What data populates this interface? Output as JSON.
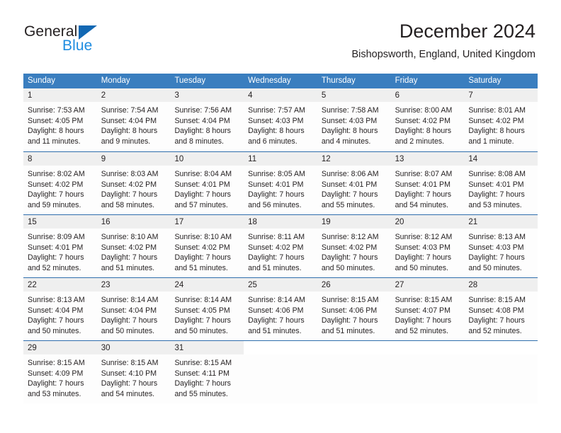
{
  "brand": {
    "name_part1": "General",
    "name_part2": "Blue",
    "triangle_icon": "triangle-icon",
    "color_dark": "#231f20",
    "color_blue": "#1e8ce0",
    "color_triangle": "#1268b3"
  },
  "header": {
    "title": "December 2024",
    "subtitle": "Bishopsworth, England, United Kingdom"
  },
  "theme": {
    "header_blue": "#3a7ebf",
    "row_divider_blue": "#2f6ead",
    "daynum_band_gray": "#efefef",
    "text": "#231f20"
  },
  "weekdays": [
    "Sunday",
    "Monday",
    "Tuesday",
    "Wednesday",
    "Thursday",
    "Friday",
    "Saturday"
  ],
  "weeks": [
    [
      {
        "day": "1",
        "sunrise": "Sunrise: 7:53 AM",
        "sunset": "Sunset: 4:05 PM",
        "daylight1": "Daylight: 8 hours",
        "daylight2": "and 11 minutes."
      },
      {
        "day": "2",
        "sunrise": "Sunrise: 7:54 AM",
        "sunset": "Sunset: 4:04 PM",
        "daylight1": "Daylight: 8 hours",
        "daylight2": "and 9 minutes."
      },
      {
        "day": "3",
        "sunrise": "Sunrise: 7:56 AM",
        "sunset": "Sunset: 4:04 PM",
        "daylight1": "Daylight: 8 hours",
        "daylight2": "and 8 minutes."
      },
      {
        "day": "4",
        "sunrise": "Sunrise: 7:57 AM",
        "sunset": "Sunset: 4:03 PM",
        "daylight1": "Daylight: 8 hours",
        "daylight2": "and 6 minutes."
      },
      {
        "day": "5",
        "sunrise": "Sunrise: 7:58 AM",
        "sunset": "Sunset: 4:03 PM",
        "daylight1": "Daylight: 8 hours",
        "daylight2": "and 4 minutes."
      },
      {
        "day": "6",
        "sunrise": "Sunrise: 8:00 AM",
        "sunset": "Sunset: 4:02 PM",
        "daylight1": "Daylight: 8 hours",
        "daylight2": "and 2 minutes."
      },
      {
        "day": "7",
        "sunrise": "Sunrise: 8:01 AM",
        "sunset": "Sunset: 4:02 PM",
        "daylight1": "Daylight: 8 hours",
        "daylight2": "and 1 minute."
      }
    ],
    [
      {
        "day": "8",
        "sunrise": "Sunrise: 8:02 AM",
        "sunset": "Sunset: 4:02 PM",
        "daylight1": "Daylight: 7 hours",
        "daylight2": "and 59 minutes."
      },
      {
        "day": "9",
        "sunrise": "Sunrise: 8:03 AM",
        "sunset": "Sunset: 4:02 PM",
        "daylight1": "Daylight: 7 hours",
        "daylight2": "and 58 minutes."
      },
      {
        "day": "10",
        "sunrise": "Sunrise: 8:04 AM",
        "sunset": "Sunset: 4:01 PM",
        "daylight1": "Daylight: 7 hours",
        "daylight2": "and 57 minutes."
      },
      {
        "day": "11",
        "sunrise": "Sunrise: 8:05 AM",
        "sunset": "Sunset: 4:01 PM",
        "daylight1": "Daylight: 7 hours",
        "daylight2": "and 56 minutes."
      },
      {
        "day": "12",
        "sunrise": "Sunrise: 8:06 AM",
        "sunset": "Sunset: 4:01 PM",
        "daylight1": "Daylight: 7 hours",
        "daylight2": "and 55 minutes."
      },
      {
        "day": "13",
        "sunrise": "Sunrise: 8:07 AM",
        "sunset": "Sunset: 4:01 PM",
        "daylight1": "Daylight: 7 hours",
        "daylight2": "and 54 minutes."
      },
      {
        "day": "14",
        "sunrise": "Sunrise: 8:08 AM",
        "sunset": "Sunset: 4:01 PM",
        "daylight1": "Daylight: 7 hours",
        "daylight2": "and 53 minutes."
      }
    ],
    [
      {
        "day": "15",
        "sunrise": "Sunrise: 8:09 AM",
        "sunset": "Sunset: 4:01 PM",
        "daylight1": "Daylight: 7 hours",
        "daylight2": "and 52 minutes."
      },
      {
        "day": "16",
        "sunrise": "Sunrise: 8:10 AM",
        "sunset": "Sunset: 4:02 PM",
        "daylight1": "Daylight: 7 hours",
        "daylight2": "and 51 minutes."
      },
      {
        "day": "17",
        "sunrise": "Sunrise: 8:10 AM",
        "sunset": "Sunset: 4:02 PM",
        "daylight1": "Daylight: 7 hours",
        "daylight2": "and 51 minutes."
      },
      {
        "day": "18",
        "sunrise": "Sunrise: 8:11 AM",
        "sunset": "Sunset: 4:02 PM",
        "daylight1": "Daylight: 7 hours",
        "daylight2": "and 51 minutes."
      },
      {
        "day": "19",
        "sunrise": "Sunrise: 8:12 AM",
        "sunset": "Sunset: 4:02 PM",
        "daylight1": "Daylight: 7 hours",
        "daylight2": "and 50 minutes."
      },
      {
        "day": "20",
        "sunrise": "Sunrise: 8:12 AM",
        "sunset": "Sunset: 4:03 PM",
        "daylight1": "Daylight: 7 hours",
        "daylight2": "and 50 minutes."
      },
      {
        "day": "21",
        "sunrise": "Sunrise: 8:13 AM",
        "sunset": "Sunset: 4:03 PM",
        "daylight1": "Daylight: 7 hours",
        "daylight2": "and 50 minutes."
      }
    ],
    [
      {
        "day": "22",
        "sunrise": "Sunrise: 8:13 AM",
        "sunset": "Sunset: 4:04 PM",
        "daylight1": "Daylight: 7 hours",
        "daylight2": "and 50 minutes."
      },
      {
        "day": "23",
        "sunrise": "Sunrise: 8:14 AM",
        "sunset": "Sunset: 4:04 PM",
        "daylight1": "Daylight: 7 hours",
        "daylight2": "and 50 minutes."
      },
      {
        "day": "24",
        "sunrise": "Sunrise: 8:14 AM",
        "sunset": "Sunset: 4:05 PM",
        "daylight1": "Daylight: 7 hours",
        "daylight2": "and 50 minutes."
      },
      {
        "day": "25",
        "sunrise": "Sunrise: 8:14 AM",
        "sunset": "Sunset: 4:06 PM",
        "daylight1": "Daylight: 7 hours",
        "daylight2": "and 51 minutes."
      },
      {
        "day": "26",
        "sunrise": "Sunrise: 8:15 AM",
        "sunset": "Sunset: 4:06 PM",
        "daylight1": "Daylight: 7 hours",
        "daylight2": "and 51 minutes."
      },
      {
        "day": "27",
        "sunrise": "Sunrise: 8:15 AM",
        "sunset": "Sunset: 4:07 PM",
        "daylight1": "Daylight: 7 hours",
        "daylight2": "and 52 minutes."
      },
      {
        "day": "28",
        "sunrise": "Sunrise: 8:15 AM",
        "sunset": "Sunset: 4:08 PM",
        "daylight1": "Daylight: 7 hours",
        "daylight2": "and 52 minutes."
      }
    ],
    [
      {
        "day": "29",
        "sunrise": "Sunrise: 8:15 AM",
        "sunset": "Sunset: 4:09 PM",
        "daylight1": "Daylight: 7 hours",
        "daylight2": "and 53 minutes."
      },
      {
        "day": "30",
        "sunrise": "Sunrise: 8:15 AM",
        "sunset": "Sunset: 4:10 PM",
        "daylight1": "Daylight: 7 hours",
        "daylight2": "and 54 minutes."
      },
      {
        "day": "31",
        "sunrise": "Sunrise: 8:15 AM",
        "sunset": "Sunset: 4:11 PM",
        "daylight1": "Daylight: 7 hours",
        "daylight2": "and 55 minutes."
      },
      {
        "day": "",
        "sunrise": "",
        "sunset": "",
        "daylight1": "",
        "daylight2": ""
      },
      {
        "day": "",
        "sunrise": "",
        "sunset": "",
        "daylight1": "",
        "daylight2": ""
      },
      {
        "day": "",
        "sunrise": "",
        "sunset": "",
        "daylight1": "",
        "daylight2": ""
      },
      {
        "day": "",
        "sunrise": "",
        "sunset": "",
        "daylight1": "",
        "daylight2": ""
      }
    ]
  ]
}
